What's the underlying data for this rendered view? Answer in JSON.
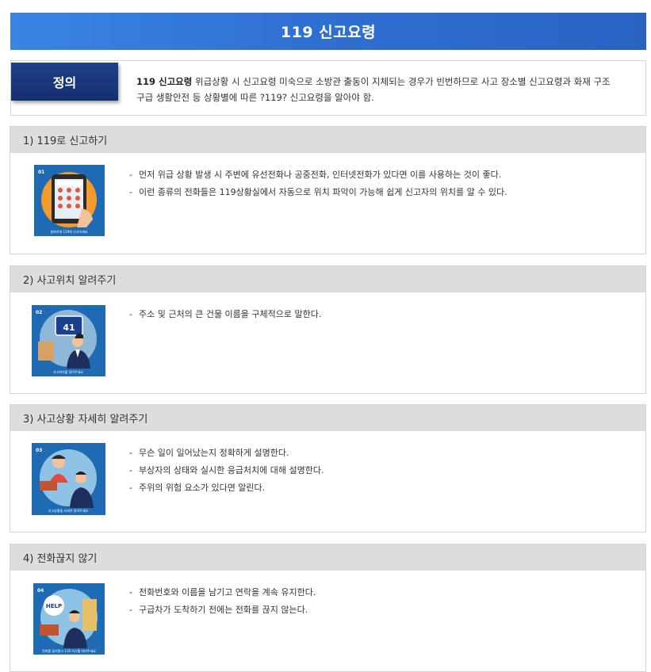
{
  "header": {
    "title": "119 신고요령"
  },
  "definition": {
    "badge": "정의",
    "lead": "119 신고요령",
    "line1": " 위급상황 시 신고요령 미숙으로 소방관 출동이 지체되는 경우가 빈번하므로 사고 장소별 신고요령과 화재 구조",
    "line2": "구급 생활안전 등 상황별에 따른 ?119? 신고요령을 알아야 함."
  },
  "sections": [
    {
      "title": "1) 119로 신고하기",
      "image": {
        "number": "01",
        "caption": "침착하게 119에 신고하세요",
        "icon": "phone-keypad-icon"
      },
      "bullets": [
        "먼저 위급 상황 발생 시 주변에 유선전화나 공중전화, 인터넷전화가 있다면 이를 사용하는 것이 좋다.",
        "이런 종류의 전화들은 119상황실에서 자동으로 위치 파악이 가능해 쉽게 신고자의 위치를 알 수 있다."
      ]
    },
    {
      "title": "2) 사고위치 알려주기",
      "image": {
        "number": "02",
        "caption": "사고위치를 알려주세요",
        "icon": "address-sign-icon",
        "sign": "41"
      },
      "bullets": [
        "주소 및 근처의 큰 건물 이름을 구체적으로 말한다."
      ]
    },
    {
      "title": "3) 사고상황 자세히 알려주기",
      "image": {
        "number": "03",
        "caption": "사고상황을 자세히 알려주세요",
        "icon": "emergency-call-icon"
      },
      "bullets": [
        "무슨 일이 일어났는지 정확하게 설명한다.",
        "부상자의 상태와 실시한 응급처치에 대해 설명한다.",
        "주위의 위험 요소가 있다면 알린다."
      ]
    },
    {
      "title": "4) 전화끊지 않기",
      "image": {
        "number": "04",
        "caption": "전화를 끊지말고 119 지시를 따라주세요",
        "icon": "help-speech-icon",
        "bubble": "HELP"
      },
      "bullets": [
        "전화번호와 이름을 남기고 연락을 계속 유지한다.",
        "구급차가 도착하기 전에는 전화를 끊지 않는다."
      ]
    }
  ]
}
